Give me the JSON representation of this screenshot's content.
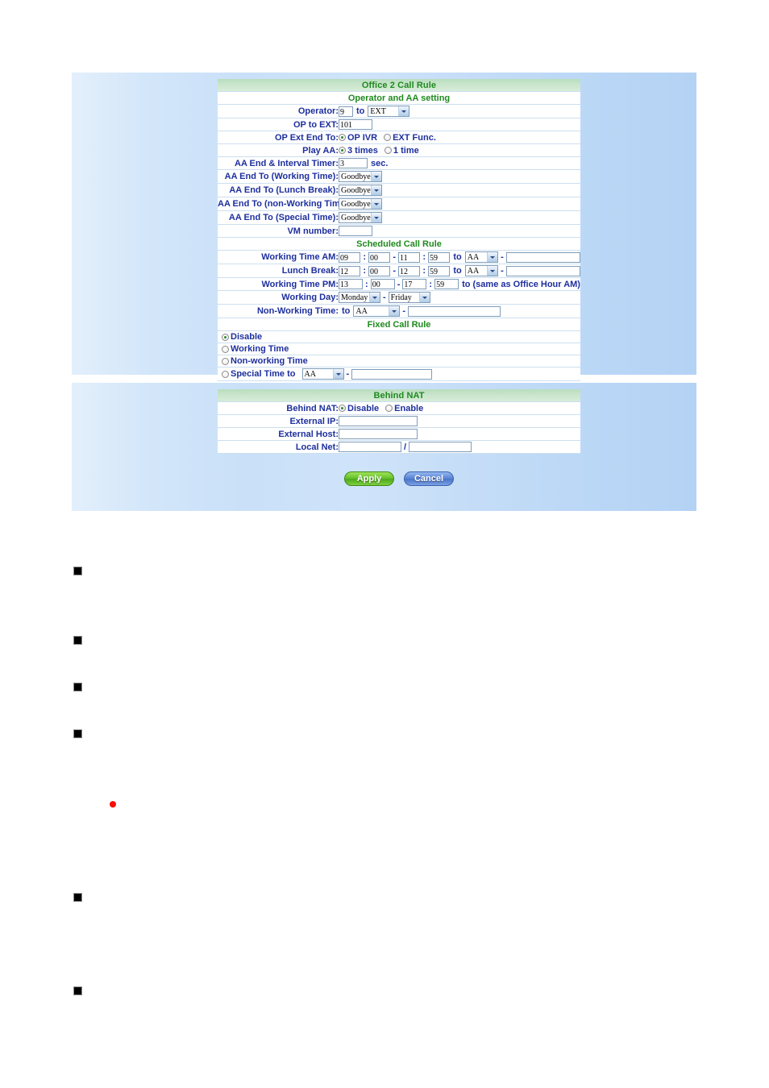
{
  "page": {
    "background_color": "#ffffff",
    "panel_gradient_from": "#e3effb",
    "panel_gradient_to": "#b4d2f4",
    "header_green": "#1f8a1f"
  },
  "call_rule": {
    "title": "Office 2 Call Rule",
    "sections": {
      "operator_aa": "Operator and AA setting",
      "scheduled": "Scheduled Call Rule",
      "fixed": "Fixed Call Rule"
    },
    "operator": {
      "label": "Operator:",
      "value": "9",
      "to_label": "to",
      "target": "EXT"
    },
    "op_to_ext": {
      "label": "OP to EXT:",
      "value": "101"
    },
    "op_ext_end_to": {
      "label": "OP Ext End To:",
      "option_1": "OP IVR",
      "option_2": "EXT Func.",
      "selected": "OP IVR"
    },
    "play_aa": {
      "label": "Play AA:",
      "option_1": "3 times",
      "option_2": "1 time",
      "selected": "3 times"
    },
    "aa_interval": {
      "label": "AA End & Interval Timer:",
      "value": "3",
      "unit": "sec."
    },
    "aa_end_working": {
      "label": "AA End To (Working Time):",
      "value": "Goodbye"
    },
    "aa_end_lunch": {
      "label": "AA End To (Lunch Break):",
      "value": "Goodbye"
    },
    "aa_end_nonworking": {
      "label": "AA End To (non-Working Time):",
      "value": "Goodbye"
    },
    "aa_end_special": {
      "label": "AA End To (Special Time):",
      "value": "Goodbye"
    },
    "vm_number": {
      "label": "VM number:",
      "value": ""
    },
    "working_time_am": {
      "label": "Working Time AM:",
      "start_hour": "09",
      "start_min": "00",
      "end_hour": "11",
      "end_min": "59",
      "to_label": "to",
      "destination": "AA",
      "extra": ""
    },
    "lunch_break": {
      "label": "Lunch Break:",
      "start_hour": "12",
      "start_min": "00",
      "end_hour": "12",
      "end_min": "59",
      "to_label": "to",
      "destination": "AA",
      "extra": ""
    },
    "working_time_pm": {
      "label": "Working Time PM:",
      "start_hour": "13",
      "start_min": "00",
      "end_hour": "17",
      "end_min": "59",
      "note": "to (same as Office Hour AM)"
    },
    "working_day": {
      "label": "Working Day:",
      "from": "Monday",
      "to": "Friday"
    },
    "non_working_time": {
      "label": "Non-Working Time:",
      "to_label": "to",
      "destination": "AA",
      "extra": ""
    },
    "fixed_options": [
      {
        "label": "Disable",
        "selected": true
      },
      {
        "label": "Working Time",
        "selected": false
      },
      {
        "label": "Non-working Time",
        "selected": false
      },
      {
        "label": "Special Time to",
        "selected": false,
        "destination": "AA",
        "extra": ""
      }
    ]
  },
  "behind_nat": {
    "title": "Behind NAT",
    "behind_nat": {
      "label": "Behind NAT:",
      "option_1": "Disable",
      "option_2": "Enable",
      "selected": "Disable"
    },
    "external_ip": {
      "label": "External IP:",
      "value": ""
    },
    "external_host": {
      "label": "External Host:",
      "value": ""
    },
    "local_net": {
      "label": "Local Net:",
      "value_1": "",
      "separator": "/",
      "value_2": ""
    }
  },
  "buttons": {
    "apply": "Apply",
    "cancel": "Cancel"
  },
  "separators": {
    "colon": ":",
    "dash": "-"
  },
  "notes": {
    "items": [
      {
        "bullet": "square",
        "text": ""
      },
      {
        "bullet": "square",
        "text": ""
      },
      {
        "bullet": "square",
        "text": ""
      },
      {
        "bullet": "square",
        "text": ""
      },
      {
        "bullet": "dot",
        "text": ""
      },
      {
        "bullet": "square",
        "text": ""
      },
      {
        "bullet": "square",
        "text": ""
      }
    ]
  }
}
